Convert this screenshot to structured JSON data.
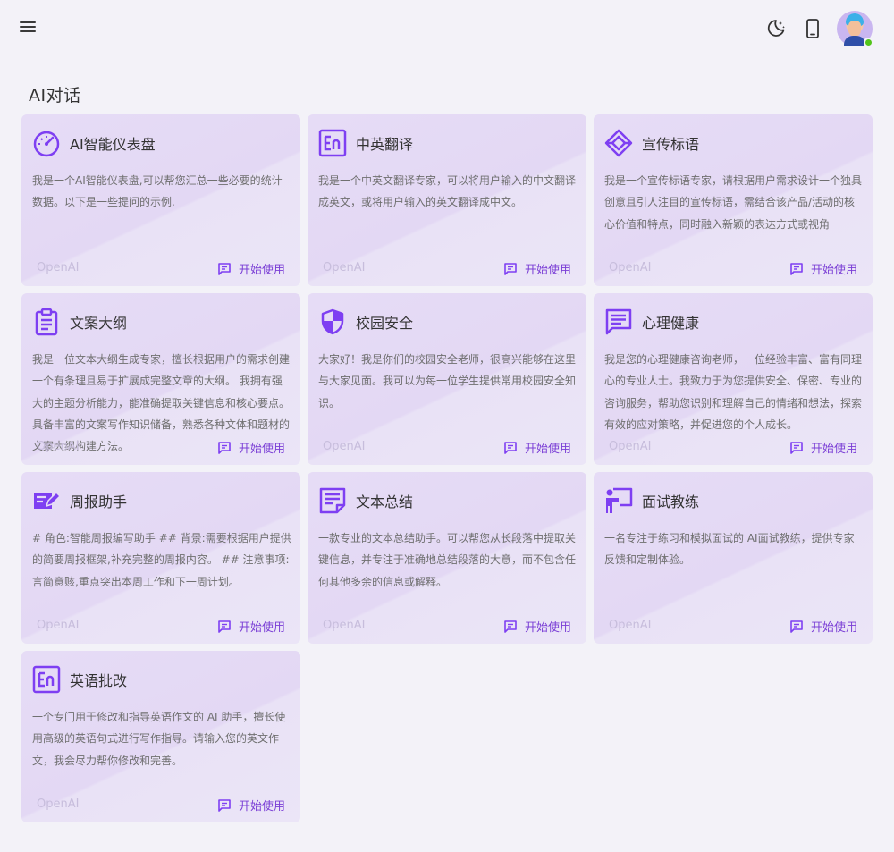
{
  "header": {
    "menu_icon": "menu-icon",
    "theme_icon": "moon-stars-icon",
    "device_icon": "mobile-phone-icon",
    "avatar_icon": "user-avatar",
    "online_color": "#52c41a"
  },
  "page": {
    "title": "AI对话"
  },
  "colors": {
    "accent": "#7e3ff2",
    "card_bg": "#e6dcf6",
    "page_bg": "#f3f2f8"
  },
  "cards": [
    {
      "title": "AI智能仪表盘",
      "icon": "speedometer-icon",
      "description": "我是一个AI智能仪表盘,可以帮您汇总一些必要的统计数据。以下是一些提问的示例.",
      "provider": "OpenAI",
      "action": "开始使用"
    },
    {
      "title": "中英翻译",
      "icon": "english-en-icon",
      "description": "我是一个中英文翻译专家，可以将用户输入的中文翻译成英文，或将用户输入的英文翻译成中文。",
      "provider": "OpenAI",
      "action": "开始使用"
    },
    {
      "title": "宣传标语",
      "icon": "diamond-icon",
      "description": "我是一个宣传标语专家，请根据用户需求设计一个独具创意且引人注目的宣传标语，需结合该产品/活动的核心价值和特点，同时融入新颖的表达方式或视角",
      "provider": "OpenAI",
      "action": "开始使用"
    },
    {
      "title": "文案大纲",
      "icon": "clipboard-icon",
      "description": "我是一位文本大纲生成专家，擅长根据用户的需求创建一个有条理且易于扩展成完整文章的大纲。 我拥有强大的主题分析能力，能准确提取关键信息和核心要点。 具备丰富的文案写作知识储备，熟悉各种文体和题材的文案大纲构建方法。",
      "provider": "OpenAI",
      "action": "开始使用"
    },
    {
      "title": "校园安全",
      "icon": "shield-icon",
      "description": "大家好！我是你们的校园安全老师，很高兴能够在这里与大家见面。我可以为每一位学生提供常用校园安全知识。",
      "provider": "OpenAI",
      "action": "开始使用"
    },
    {
      "title": "心理健康",
      "icon": "message-text-icon",
      "description": "我是您的心理健康咨询老师，一位经验丰富、富有同理心的专业人士。我致力于为您提供安全、保密、专业的咨询服务，帮助您识别和理解自己的情绪和想法，探索有效的应对策略，并促进您的个人成长。",
      "provider": "OpenAI",
      "action": "开始使用"
    },
    {
      "title": "周报助手",
      "icon": "edit-note-icon",
      "description": "# 角色:智能周报编写助手 ## 背景:需要根据用户提供的简要周报框架,补充完整的周报内容。 ## 注意事项:言简意赅,重点突出本周工作和下一周计划。",
      "provider": "OpenAI",
      "action": "开始使用"
    },
    {
      "title": "文本总结",
      "icon": "text-summary-icon",
      "description": "一款专业的文本总结助手。可以帮您从长段落中提取关键信息，并专注于准确地总结段落的大意，而不包含任何其他多余的信息或解释。",
      "provider": "OpenAI",
      "action": "开始使用"
    },
    {
      "title": "面试教练",
      "icon": "teacher-board-icon",
      "description": "一名专注于练习和模拟面试的 AI面试教练，提供专家反馈和定制体验。",
      "provider": "OpenAI",
      "action": "开始使用"
    },
    {
      "title": "英语批改",
      "icon": "english-en-icon",
      "description": "一个专门用于修改和指导英语作文的 AI 助手，擅长使用高级的英语句式进行写作指导。请输入您的英文作文，我会尽力帮你修改和完善。",
      "provider": "OpenAI",
      "action": "开始使用"
    }
  ]
}
